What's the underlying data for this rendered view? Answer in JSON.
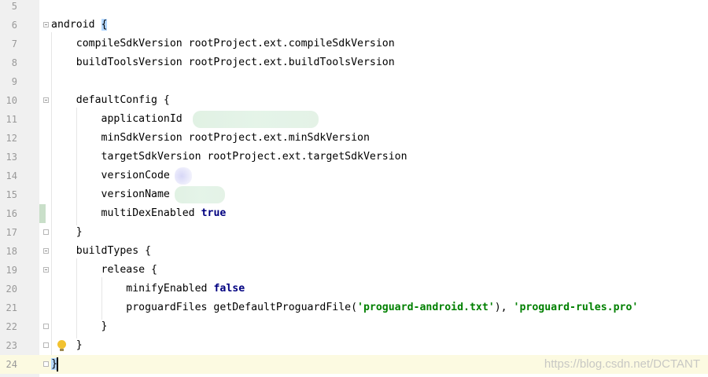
{
  "lines": [
    {
      "num": "5",
      "code": ""
    },
    {
      "num": "6",
      "code": "android "
    },
    {
      "num": "7",
      "code": "    compileSdkVersion rootProject.ext.compileSdkVersion"
    },
    {
      "num": "8",
      "code": "    buildToolsVersion rootProject.ext.buildToolsVersion"
    },
    {
      "num": "9",
      "code": ""
    },
    {
      "num": "10",
      "code": "    defaultConfig {"
    },
    {
      "num": "11",
      "code": "        applicationId"
    },
    {
      "num": "12",
      "code": "        minSdkVersion rootProject.ext.minSdkVersion"
    },
    {
      "num": "13",
      "code": "        targetSdkVersion rootProject.ext.targetSdkVersion"
    },
    {
      "num": "14",
      "code": "        versionCode"
    },
    {
      "num": "15",
      "code": "        versionName"
    },
    {
      "num": "16",
      "code": "        multiDexEnabled "
    },
    {
      "num": "17",
      "code": "    }"
    },
    {
      "num": "18",
      "code": "    buildTypes {"
    },
    {
      "num": "19",
      "code": "        release {"
    },
    {
      "num": "20",
      "code": "            minifyEnabled "
    },
    {
      "num": "21",
      "code": "            proguardFiles getDefaultProguardFile("
    },
    {
      "num": "22",
      "code": "        }"
    },
    {
      "num": "23",
      "code": "    }"
    },
    {
      "num": "24",
      "code": ""
    }
  ],
  "tokens": {
    "open_brace": "{",
    "close_brace": "}",
    "kw_true": "true",
    "kw_false": "false",
    "str_proguard_android": "'proguard-android.txt'",
    "sep": "), ",
    "str_proguard_rules": "'proguard-rules.pro'"
  },
  "watermark": "https://blog.csdn.net/DCTANT",
  "colors": {
    "keyword": "#000080",
    "string": "#008000",
    "current_line": "#fcfae1",
    "brace_highlight": "#b3d7ff"
  },
  "icons": {
    "line23": "lightbulb-icon"
  }
}
